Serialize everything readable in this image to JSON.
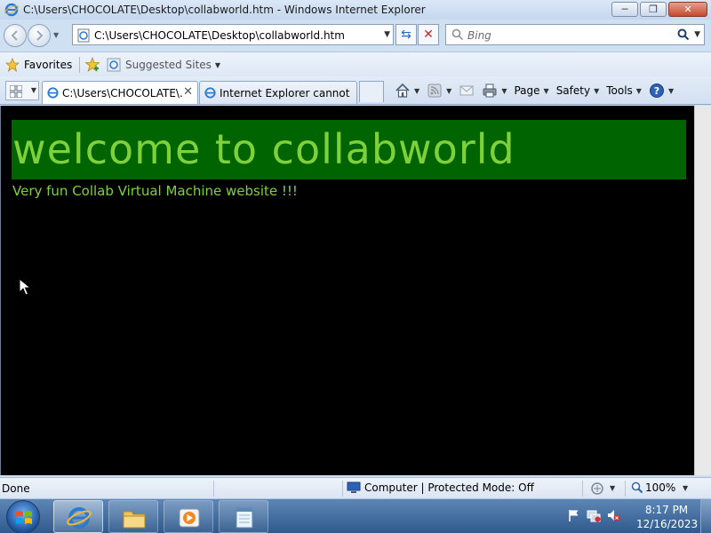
{
  "window": {
    "title": "C:\\Users\\CHOCOLATE\\Desktop\\collabworld.htm - Windows Internet Explorer"
  },
  "caption": {
    "minimize": "─",
    "maximize": "❐",
    "close": "✕"
  },
  "address": {
    "value": "C:\\Users\\CHOCOLATE\\Desktop\\collabworld.htm"
  },
  "search": {
    "placeholder": "Bing"
  },
  "favorites_bar": {
    "favorites_label": "Favorites",
    "suggested_label": "Suggested Sites"
  },
  "tabs": [
    {
      "label": "C:\\Users\\CHOCOLATE\\...",
      "active": true
    },
    {
      "label": "Internet Explorer cannot di...",
      "active": false
    }
  ],
  "command_bar": {
    "page_label": "Page",
    "safety_label": "Safety",
    "tools_label": "Tools"
  },
  "page": {
    "heading": "welcome to collabworld",
    "subtitle": "Very fun Collab Virtual Machine website !!!",
    "banner_color": "#006400",
    "text_color": "#7fd13b",
    "background": "#000000"
  },
  "status": {
    "text": "Done",
    "zone": "Computer | Protected Mode: Off",
    "zoom": "100%"
  },
  "taskbar": {
    "time": "8:17 PM",
    "date": "12/16/2023",
    "items": [
      "ie-icon",
      "folder-icon",
      "media-player-icon",
      "notepad-icon"
    ]
  }
}
